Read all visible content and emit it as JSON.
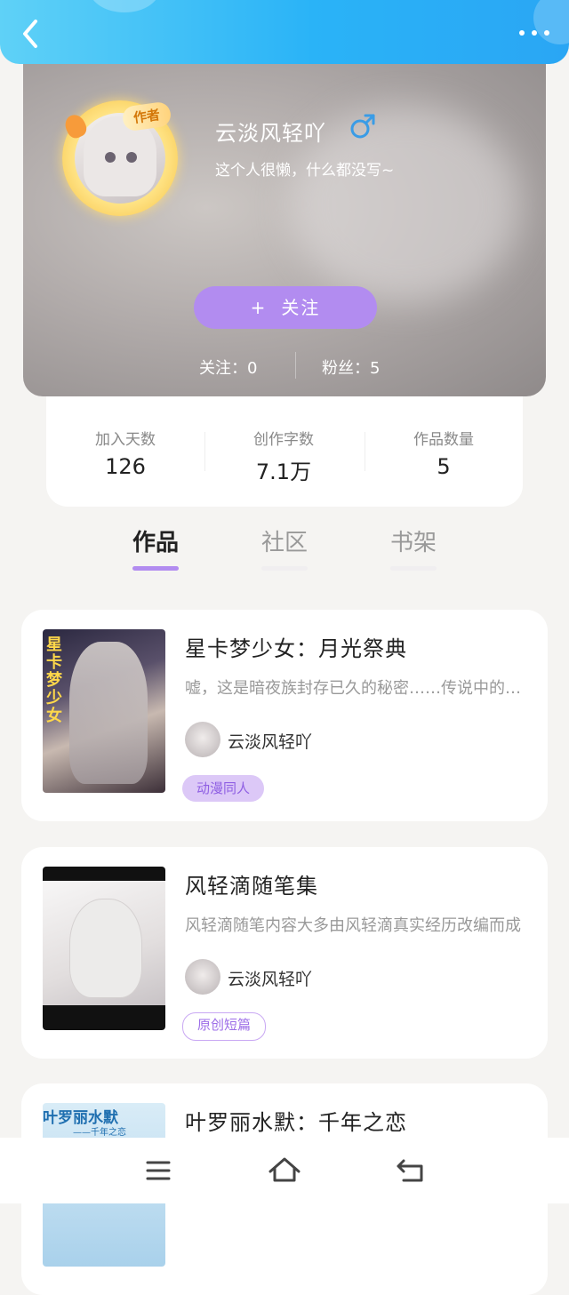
{
  "header": {
    "back_icon": "chevron-left-icon",
    "more_icon": "more-dots-icon"
  },
  "profile": {
    "username": "云淡风轻吖",
    "gender_icon": "male-icon",
    "gender_color": "#3a9ce6",
    "bio": "这个人很懒，什么都没写~",
    "avatar_badge": "作者",
    "follow_button": "关注",
    "follow_plus": "+",
    "following_label": "关注：0",
    "fans_label": "粉丝：5"
  },
  "stats": [
    {
      "label": "加入天数",
      "value": "126"
    },
    {
      "label": "创作字数",
      "value": "7.1万"
    },
    {
      "label": "作品数量",
      "value": "5"
    }
  ],
  "tabs": [
    {
      "label": "作品",
      "active": true
    },
    {
      "label": "社区",
      "active": false
    },
    {
      "label": "书架",
      "active": false
    }
  ],
  "works": [
    {
      "title": "星卡梦少女：月光祭典",
      "desc": "嘘，这是暗夜族封存已久的秘密……传说中的月光祭典即将开启",
      "author": "云淡风轻吖",
      "tag": "动漫同人",
      "cover_text": "星卡梦少女"
    },
    {
      "title": "风轻滴随笔集",
      "desc": "风轻滴随笔内容大多由风轻滴真实经历改编而成",
      "author": "云淡风轻吖",
      "tag": "原创短篇"
    },
    {
      "title": "叶罗丽水默：千年之恋",
      "cover_text": "叶罗丽水默",
      "cover_sub": "——千年之恋"
    }
  ],
  "nav": {
    "menu_icon": "menu-icon",
    "home_icon": "home-icon",
    "back_icon": "return-icon"
  },
  "colors": {
    "accent": "#b28cf0",
    "header": "#2ab3f7"
  }
}
